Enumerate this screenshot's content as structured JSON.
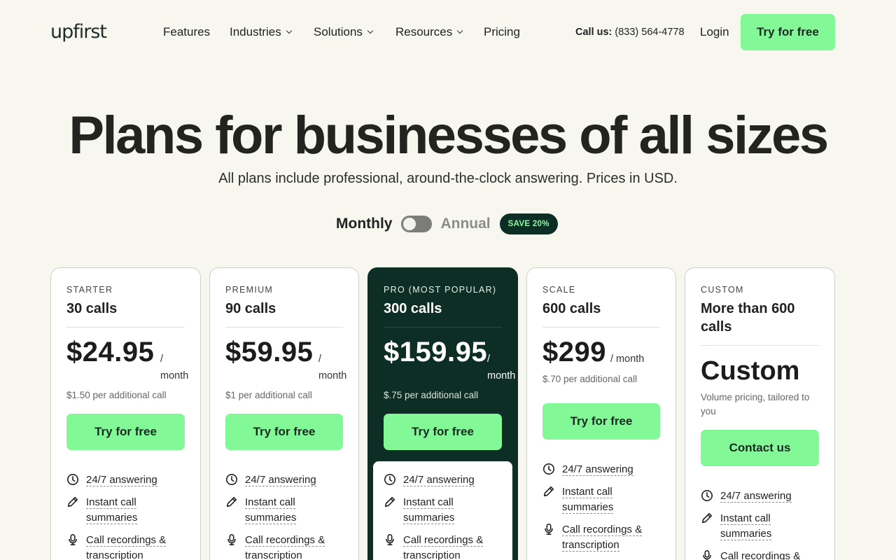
{
  "nav": {
    "logo": "upfirst",
    "links": [
      {
        "label": "Features"
      },
      {
        "label": "Industries"
      },
      {
        "label": "Solutions"
      },
      {
        "label": "Resources"
      },
      {
        "label": "Pricing"
      }
    ],
    "call_label": "Call us:",
    "phone": "(833) 564-4778",
    "login": "Login",
    "cta": "Try for free"
  },
  "hero": {
    "title": "Plans for businesses of all sizes",
    "subtitle": "All plans include professional, around-the-clock answering. Prices in USD."
  },
  "billing_toggle": {
    "monthly": "Monthly",
    "annual": "Annual",
    "badge": "SAVE 20%",
    "selected": "Monthly"
  },
  "plans": [
    {
      "tier": "STARTER",
      "calls": "30 calls",
      "price": "$24.95",
      "per": "/",
      "per2": "month",
      "extra": "$1.50 per additional call",
      "cta": "Try for free"
    },
    {
      "tier": "PREMIUM",
      "calls": "90 calls",
      "price": "$59.95",
      "per": "/",
      "per2": "month",
      "extra": "$1 per additional call",
      "cta": "Try for free"
    },
    {
      "tier": "PRO (MOST POPULAR)",
      "calls": "300 calls",
      "price": "$159.95",
      "per": "/",
      "per2": "month",
      "extra": "$.75 per additional call",
      "cta": "Try for free"
    },
    {
      "tier": "SCALE",
      "calls": "600 calls",
      "price": "$299",
      "per": "/ month",
      "extra": "$.70 per additional call",
      "cta": "Try for free"
    },
    {
      "tier": "CUSTOM",
      "calls_line1": "More than 600",
      "calls_line2": "calls",
      "price": "Custom",
      "extra_line1": "Volume pricing, tailored to",
      "extra_line2": "you",
      "cta": "Contact us"
    }
  ],
  "features": [
    {
      "icon": "clock-icon",
      "line1": "24/7 answering",
      "line2": ""
    },
    {
      "icon": "pencil-icon",
      "line1": "Instant call",
      "line2": "summaries"
    },
    {
      "icon": "microphone-icon",
      "line1": "Call recordings &",
      "line2": "transcription"
    }
  ],
  "colors": {
    "accent": "#82f996",
    "dark": "#0d2e25",
    "background": "#f7f7f0"
  }
}
